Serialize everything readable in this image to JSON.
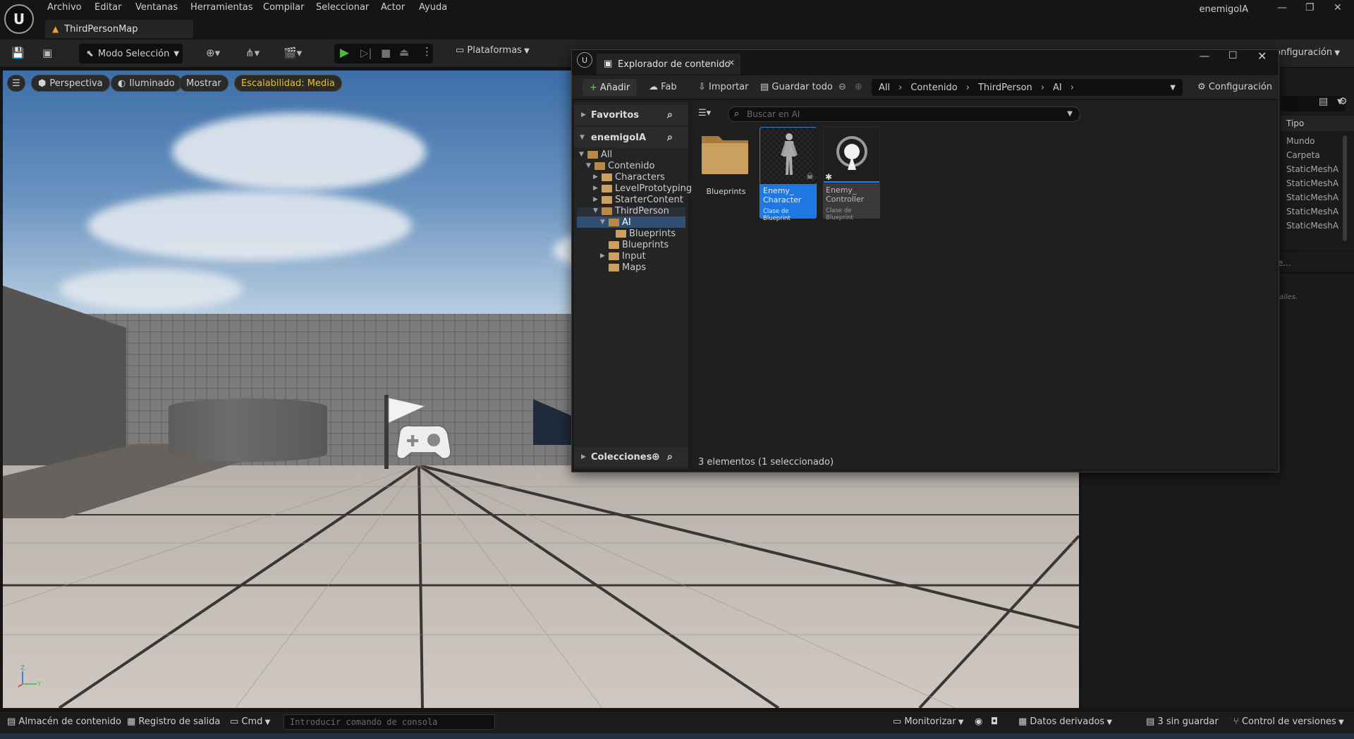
{
  "menu": {
    "items": [
      "Archivo",
      "Editar",
      "Ventanas",
      "Herramientas",
      "Compilar",
      "Seleccionar",
      "Actor",
      "Ayuda"
    ],
    "project": "enemigoIA"
  },
  "level_tab": {
    "label": "ThirdPersonMap"
  },
  "toolbar": {
    "mode": "Modo Selección",
    "platforms": "Plataformas",
    "settings": "onfiguración"
  },
  "viewport": {
    "perspective": "Perspectiva",
    "lit": "Iluminado",
    "show": "Mostrar",
    "scalability": "Escalabilidad: Media"
  },
  "right_panel": {
    "column": "Tipo",
    "rows": [
      "Mundo",
      "Carpeta",
      "StaticMeshA",
      "StaticMeshA",
      "StaticMeshA",
      "StaticMeshA",
      "StaticMeshA"
    ],
    "details_hint": "e...",
    "footer_hint": "alles."
  },
  "content_browser": {
    "title": "Explorador de contenido",
    "toolbar": {
      "add": "Añadir",
      "fab": "Fab",
      "import": "Importar",
      "save_all": "Guardar todo",
      "settings": "Configuración"
    },
    "path": [
      "All",
      "Contenido",
      "ThirdPerson",
      "AI"
    ],
    "sidebar": {
      "favorites": "Favoritos",
      "project": "enemigoIA",
      "collections": "Colecciones",
      "tree": [
        {
          "label": "All"
        },
        {
          "label": "Contenido"
        },
        {
          "label": "Characters"
        },
        {
          "label": "LevelPrototyping"
        },
        {
          "label": "StarterContent"
        },
        {
          "label": "ThirdPerson"
        },
        {
          "label": "AI"
        },
        {
          "label": "Blueprints"
        },
        {
          "label": "Blueprints"
        },
        {
          "label": "Input"
        },
        {
          "label": "Maps"
        }
      ]
    },
    "search_placeholder": "Buscar en AI",
    "assets": [
      {
        "name": "Blueprints",
        "type": ""
      },
      {
        "name": "Enemy_ Character",
        "type": "Clase de Blueprint"
      },
      {
        "name": "Enemy_ Controller",
        "type": "Clase de Blueprint"
      }
    ],
    "count": "3 elementos (1 seleccionado)"
  },
  "statusbar": {
    "content_drawer": "Almacén de contenido",
    "output_log": "Registro de salida",
    "cmd": "Cmd",
    "console_placeholder": "Introducir comando de consola",
    "monitor": "Monitorizar",
    "derived_data": "Datos derivados",
    "unsaved": "3 sin guardar",
    "source_control": "Control de versiones"
  }
}
